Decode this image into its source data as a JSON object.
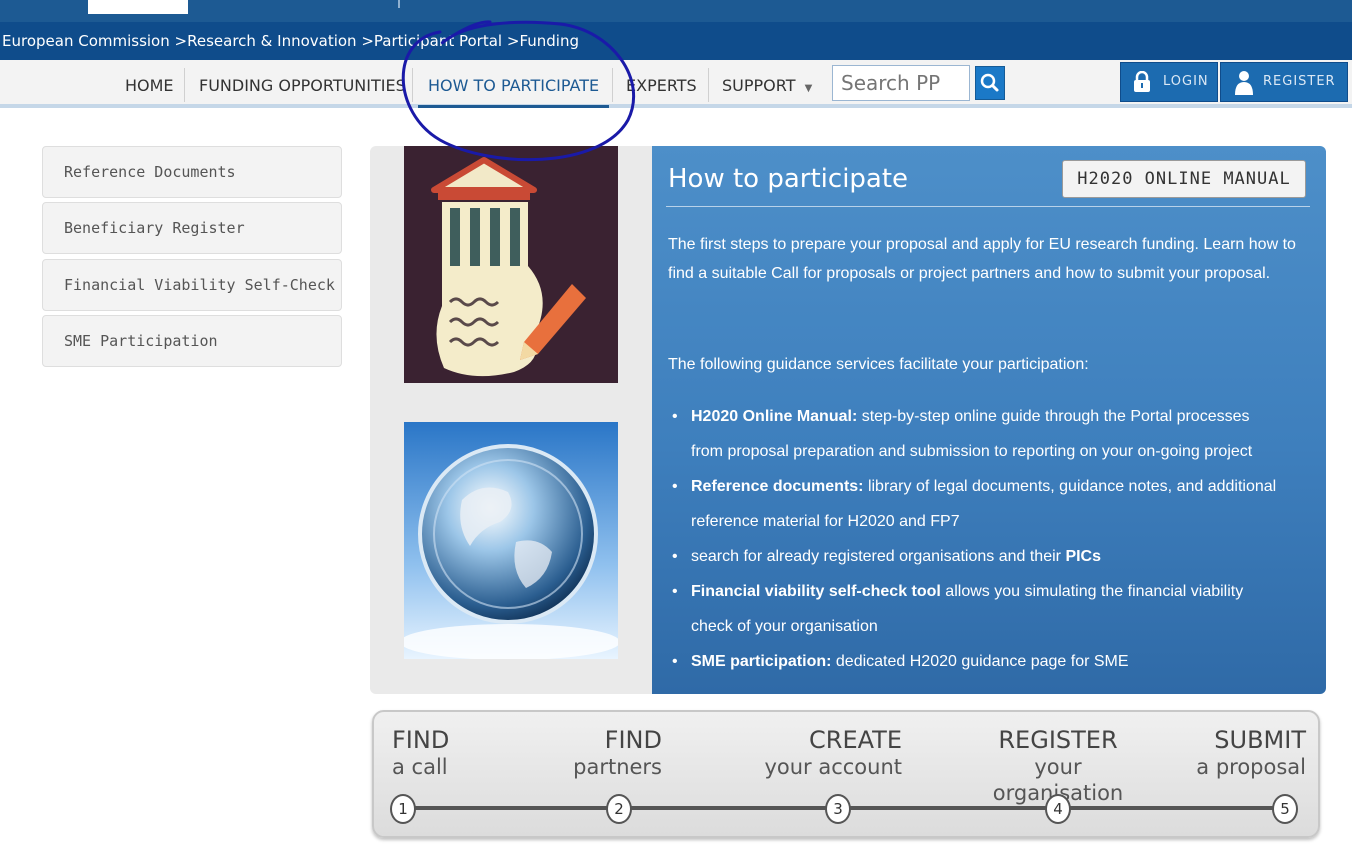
{
  "breadcrumb": {
    "items": [
      "European Commission",
      "Research & Innovation",
      "Participant Portal",
      "Funding"
    ],
    "separator": ">"
  },
  "nav": {
    "items": [
      {
        "label": "HOME"
      },
      {
        "label": "FUNDING OPPORTUNITIES"
      },
      {
        "label": "HOW TO PARTICIPATE",
        "active": true
      },
      {
        "label": "EXPERTS"
      },
      {
        "label": "SUPPORT"
      }
    ],
    "support_caret": "▼",
    "search_placeholder": "Search PP",
    "login_label": "LOGIN",
    "register_label": "REGISTER"
  },
  "sidebar": {
    "items": [
      {
        "label": "Reference Documents"
      },
      {
        "label": "Beneficiary Register"
      },
      {
        "label": "Financial Viability Self-Check"
      },
      {
        "label": "SME Participation"
      }
    ]
  },
  "main": {
    "title": "How to participate",
    "manual_button": "H2020 ONLINE MANUAL",
    "intro": "The first steps to prepare your proposal and apply for EU research funding. Learn how to find a suitable Call for proposals or project partners and how to submit your proposal.",
    "guidance_heading": "The following guidance services facilitate your participation:",
    "bullets": [
      {
        "bold": "H2020 Online Manual:",
        "text": " step-by-step online guide through the Portal processes",
        "text2": "from proposal preparation and submission to reporting on your on-going project"
      },
      {
        "bold": "Reference documents:",
        "text": " library of legal documents, guidance notes, and additional",
        "text2": "reference material for H2020 and FP7"
      },
      {
        "pre": "search for already registered organisations and their ",
        "bold": "PICs"
      },
      {
        "bold": "Financial viability self-check tool",
        "text": " allows you simulating the financial viability",
        "text2": "check of your organisation"
      },
      {
        "bold": "SME participation:",
        "text": " dedicated H2020 guidance page for SME"
      }
    ]
  },
  "steps": [
    {
      "title": "FIND",
      "subtitle": "a call",
      "number": "1"
    },
    {
      "title": "FIND",
      "subtitle": "partners",
      "number": "2"
    },
    {
      "title": "CREATE",
      "subtitle": "your account",
      "number": "3"
    },
    {
      "title": "REGISTER",
      "subtitle": "your organisation",
      "number": "4"
    },
    {
      "title": "SUBMIT",
      "subtitle": "a proposal",
      "number": "5"
    }
  ],
  "colors": {
    "header_blue": "#0f4c8b",
    "panel_blue": "#3e7fbd",
    "active_blue": "#1d5a93",
    "annotation_ink": "#1a1aa8"
  }
}
